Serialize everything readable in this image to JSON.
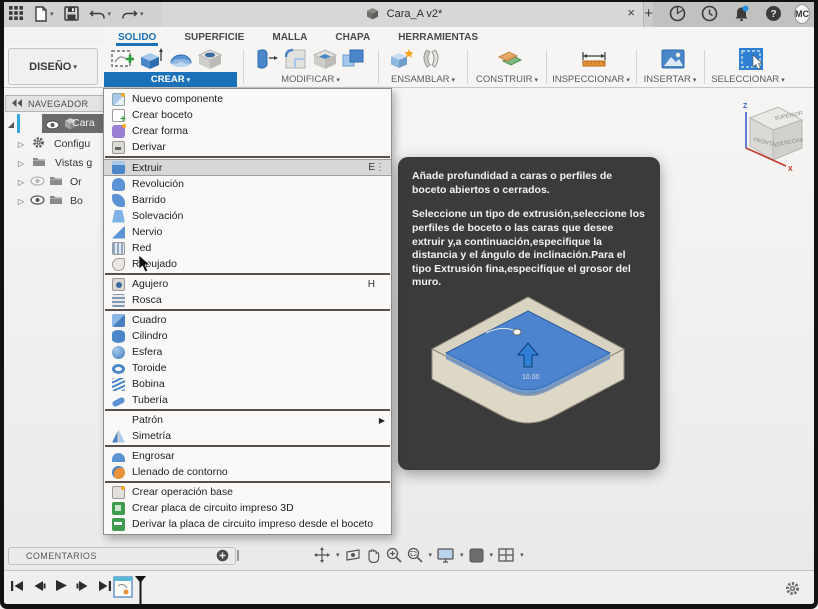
{
  "titlebar": {
    "document_title": "Cara_A v2*",
    "close_label": "×",
    "new_tab_label": "+",
    "avatar_initials": "MC",
    "icons": [
      "app-grid-icon",
      "file-icon",
      "save-icon",
      "undo-icon",
      "redo-icon",
      "extensions-icon",
      "job-status-icon",
      "notifications-icon",
      "help-icon"
    ]
  },
  "ribbon": {
    "design_label": "DISEÑO",
    "active_tab": "SOLIDO",
    "tabs": [
      "SOLIDO",
      "SUPERFICIE",
      "MALLA",
      "CHAPA",
      "HERRAMIENTAS"
    ],
    "groups": [
      {
        "label": "CREAR",
        "active": true
      },
      {
        "label": "MODIFICAR"
      },
      {
        "label": "ENSAMBLAR"
      },
      {
        "label": "CONSTRUIR"
      },
      {
        "label": "INSPECCIONAR"
      },
      {
        "label": "INSERTAR"
      },
      {
        "label": "SELECCIONAR"
      }
    ]
  },
  "navigator": {
    "header": "NAVEGADOR",
    "items": [
      {
        "label": "Cara",
        "selected": true
      },
      {
        "label": "Configu"
      },
      {
        "label": "Vistas g"
      },
      {
        "label": "Or",
        "hidden": true
      },
      {
        "label": "Bo"
      }
    ]
  },
  "create_menu": {
    "items": [
      {
        "icon": "new-component",
        "label": "Nuevo componente"
      },
      {
        "icon": "create-sketch",
        "label": "Crear boceto"
      },
      {
        "icon": "create-form",
        "label": "Crear forma"
      },
      {
        "icon": "derive",
        "label": "Derivar",
        "sep_after": true
      },
      {
        "icon": "extrude",
        "label": "Extruir",
        "shortcut": "E",
        "highlighted": true,
        "more": true
      },
      {
        "icon": "revolve",
        "label": "Revolución"
      },
      {
        "icon": "sweep",
        "label": "Barrido"
      },
      {
        "icon": "loft",
        "label": "Solevación"
      },
      {
        "icon": "rib",
        "label": "Nervio"
      },
      {
        "icon": "web",
        "label": "Red"
      },
      {
        "icon": "emboss",
        "label": "Repujado",
        "sep_after": true
      },
      {
        "icon": "hole",
        "label": "Agujero",
        "shortcut": "H"
      },
      {
        "icon": "thread",
        "label": "Rosca",
        "sep_after": true
      },
      {
        "icon": "box",
        "label": "Cuadro"
      },
      {
        "icon": "cylinder",
        "label": "Cilindro"
      },
      {
        "icon": "sphere",
        "label": "Esfera"
      },
      {
        "icon": "torus",
        "label": "Toroide"
      },
      {
        "icon": "coil",
        "label": "Bobina"
      },
      {
        "icon": "pipe",
        "label": "Tubería",
        "sep_after": true
      },
      {
        "icon": "none",
        "label": "Patrón",
        "submenu": true
      },
      {
        "icon": "mirror",
        "label": "Simetría",
        "sep_after": true
      },
      {
        "icon": "thicken",
        "label": "Engrosar"
      },
      {
        "icon": "boundary-fill",
        "label": "Llenado de contorno",
        "sep_after": true
      },
      {
        "icon": "base-feature",
        "label": "Crear operación base"
      },
      {
        "icon": "pcb-3d",
        "label": "Crear placa de circuito impreso 3D"
      },
      {
        "icon": "pcb-derive",
        "label": "Derivar la placa de circuito impreso desde el boceto"
      }
    ]
  },
  "tooltip": {
    "paragraph1": "Añade profundidad a caras o perfiles de boceto abiertos o cerrados.",
    "paragraph2": "Seleccione un tipo de extrusión,seleccione los perfiles de boceto o las caras que desee extruir y,a continuación,especifique la distancia y el ángulo de inclinación.Para el tipo Extrusión fina,especifique el grosor del muro.",
    "dimension_value": "10.00"
  },
  "viewcube": {
    "top": "SUPERIOR",
    "front": "FRONTAL",
    "right": "DERECHA",
    "axis_x": "X",
    "axis_z": "Z"
  },
  "comments": {
    "label": "COMENTARIOS"
  },
  "colors": {
    "accent_blue": "#1b72b8",
    "tooltip_bg": "#3b3b3b",
    "menu_highlight": "#d9d7d5",
    "selection_dark": "#6b6b6b",
    "axis_x_red": "#c0392b",
    "axis_z_blue": "#3a5fcd"
  }
}
